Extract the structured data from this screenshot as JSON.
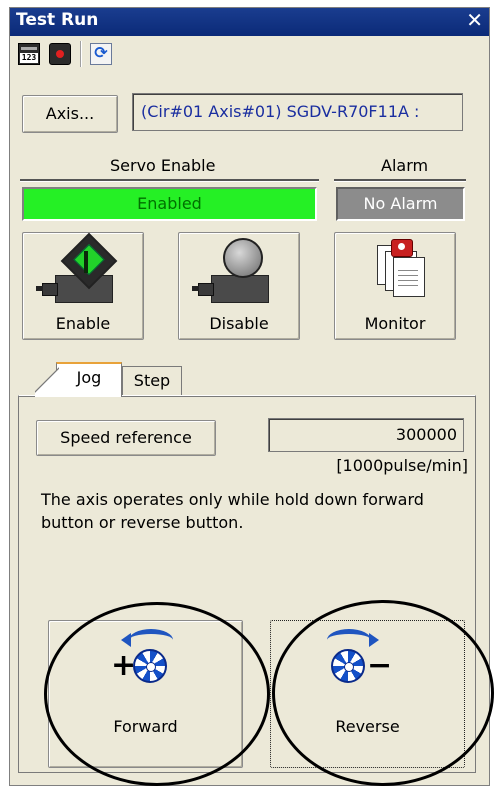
{
  "window": {
    "title": "Test Run",
    "close_glyph": "✕"
  },
  "toolbar": {
    "icons": [
      "calculator-icon",
      "record-icon",
      "refresh-icon"
    ],
    "calc_text": "123",
    "refresh_glyph": "⟳"
  },
  "axis": {
    "button_label": "Axis...",
    "value": "(Cir#01 Axis#01) SGDV-R70F11A :"
  },
  "servo": {
    "label": "Servo Enable",
    "status": "Enabled",
    "status_color": "#25f025"
  },
  "alarm": {
    "label": "Alarm",
    "status": "No Alarm",
    "status_color": "#8c8c8c"
  },
  "actions": {
    "enable": "Enable",
    "disable": "Disable",
    "monitor": "Monitor"
  },
  "tabs": [
    {
      "label": "Jog",
      "active": true
    },
    {
      "label": "Step",
      "active": false
    }
  ],
  "jog": {
    "speed_button": "Speed reference",
    "speed_value": "300000",
    "speed_unit": "[1000pulse/min]",
    "description": "The axis operates only while hold down forward button or reverse button.",
    "forward": {
      "label": "Forward",
      "sign": "+"
    },
    "reverse": {
      "label": "Reverse",
      "sign": "−"
    }
  }
}
